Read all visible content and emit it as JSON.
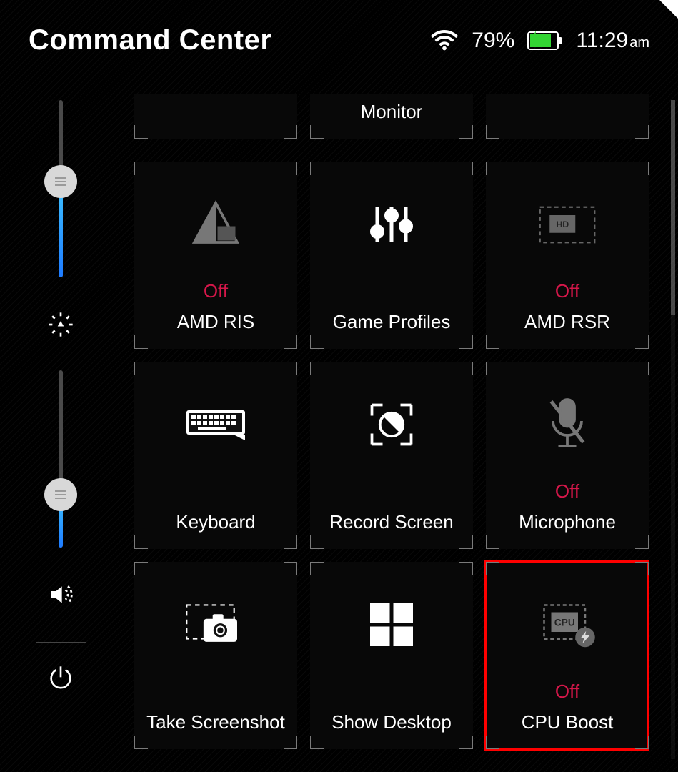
{
  "header": {
    "title": "Command Center",
    "battery_percent": "79%",
    "time": "11:29",
    "time_ampm": "am"
  },
  "colors": {
    "status_off": "#d6174a",
    "highlight": "#ff0000",
    "slider_gradient_bottom": "#1e7bff",
    "slider_gradient_top": "#3fc4ff"
  },
  "sliders": {
    "brightness": {
      "fill_percent": 54
    },
    "volume": {
      "fill_percent": 30
    }
  },
  "tiles_top_peek": [
    {
      "title": ""
    },
    {
      "title": "Monitor"
    },
    {
      "title": ""
    }
  ],
  "tiles": [
    {
      "id": "amd-ris",
      "title": "AMD RIS",
      "status": "Off"
    },
    {
      "id": "game-profiles",
      "title": "Game Profiles",
      "status": ""
    },
    {
      "id": "amd-rsr",
      "title": "AMD RSR",
      "status": "Off"
    },
    {
      "id": "keyboard",
      "title": "Keyboard",
      "status": ""
    },
    {
      "id": "record-screen",
      "title": "Record Screen",
      "status": ""
    },
    {
      "id": "microphone",
      "title": "Microphone",
      "status": "Off"
    },
    {
      "id": "take-screenshot",
      "title": "Take Screenshot",
      "status": ""
    },
    {
      "id": "show-desktop",
      "title": "Show Desktop",
      "status": ""
    },
    {
      "id": "cpu-boost",
      "title": "CPU Boost",
      "status": "Off",
      "highlight": true
    }
  ]
}
